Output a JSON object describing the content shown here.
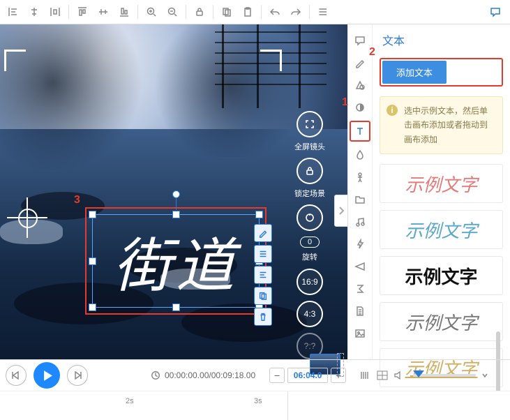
{
  "toolbar": {
    "buttons": [
      "align-left",
      "align-center",
      "align-distrib",
      "align-top",
      "align-middle",
      "align-bottom",
      "zoom-in",
      "zoom-out",
      "lock",
      "copy",
      "paste",
      "undo",
      "redo",
      "list"
    ],
    "chat": "chat"
  },
  "markers": {
    "m1": "1",
    "m2": "2",
    "m3": "3"
  },
  "canvas": {
    "text_content": "街道",
    "tool_labels": {
      "fullscreen": "全屏镜头",
      "lock_scene": "锁定场景",
      "rotate": "旋转",
      "rotate_value": "0",
      "ratio_16_9": "16:9",
      "ratio_4_3": "4:3",
      "ratio_free": "?:?"
    }
  },
  "vtoolbar": [
    "comment",
    "edit",
    "shape",
    "opacity",
    "text",
    "water",
    "person",
    "folder",
    "music",
    "bolt",
    "plane",
    "sigma",
    "doc",
    "image"
  ],
  "right": {
    "title": "文本",
    "add_button": "添加文本",
    "hint": "选中示例文本，然后单击画布添加或者拖动到画布添加",
    "hint_icon": "i",
    "styles": [
      "示例文字",
      "示例文字",
      "示例文字",
      "示例文字",
      "示例文字"
    ]
  },
  "playbar": {
    "timecode": "00:00:00.00/00:09:18.00",
    "zoom_value": "06:04.0"
  },
  "timeline": {
    "tick1": "2s",
    "tick2": "3s"
  }
}
